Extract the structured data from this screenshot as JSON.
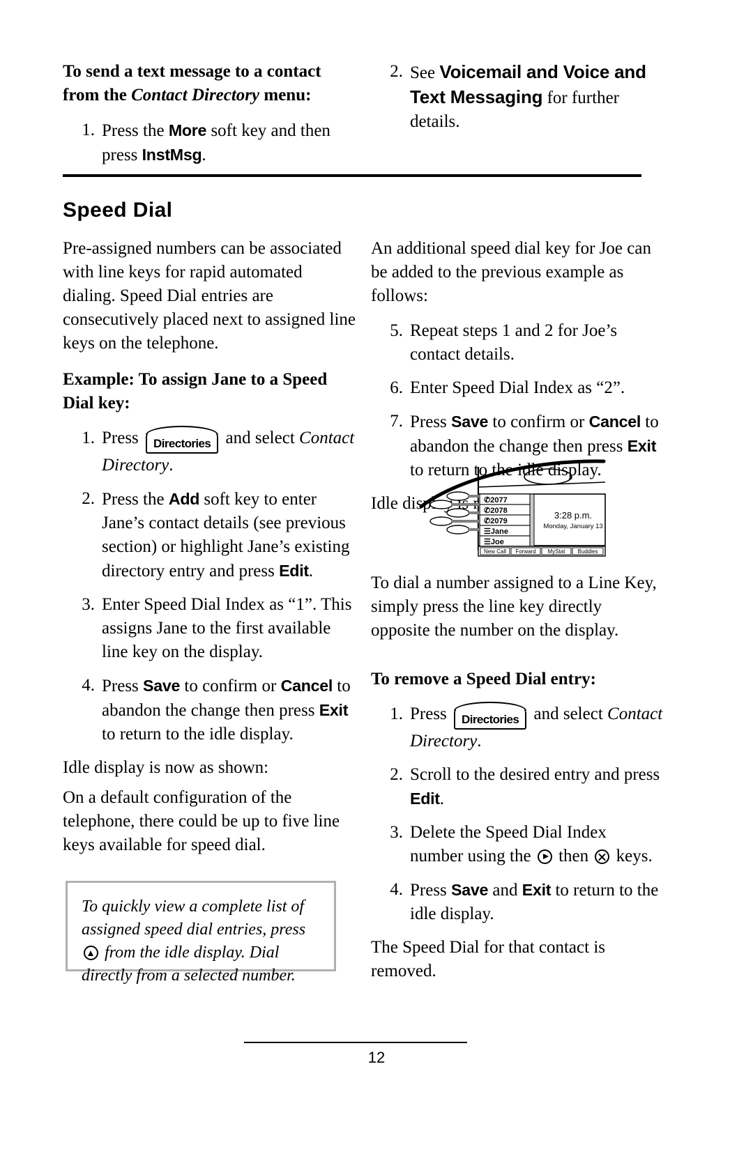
{
  "page": {
    "number": "12"
  },
  "top_left": {
    "heading_part1": "To send a text message to a contact from the ",
    "heading_italic": "Contact Directory",
    "heading_part2": " menu:",
    "steps": [
      {
        "num": "1.",
        "text_a": "Press the ",
        "key_a": "More",
        "text_b": " soft key and then press ",
        "key_b": "InstMsg",
        "text_c": "."
      }
    ]
  },
  "top_right": {
    "steps": [
      {
        "num": "2.",
        "text_a": "See ",
        "bold_a": "Voicemail and Voice and Text Messaging",
        "text_b": " for further details."
      }
    ]
  },
  "section": {
    "title": "Speed Dial"
  },
  "left_column": {
    "intro": "Pre-assigned numbers can be associated with line keys for rapid automated dialing. Speed Dial entries are consecutively placed next to assigned line keys on the telephone.",
    "example_heading": "Example: To assign Jane to a Speed Dial key:",
    "steps": [
      {
        "num": "1.",
        "text_a": "Press ",
        "hardkey": "Directories",
        "text_b": " and select ",
        "italic_b": "Contact Directory",
        "text_c": "."
      },
      {
        "num": "2.",
        "text_a": "Press the ",
        "key_a": "Add",
        "text_b": " soft key to enter Jane’s contact details (see previous section) or highlight Jane’s existing directory entry and press ",
        "key_b": "Edit",
        "text_c": "."
      },
      {
        "num": "3.",
        "text_a": "Enter Speed Dial Index as “1”.  This assigns Jane to the first available line key on the display."
      },
      {
        "num": "4.",
        "text_a": "Press ",
        "key_a": "Save",
        "text_b": " to confirm or ",
        "key_b": "Cancel",
        "text_c": " to abandon the change then press ",
        "key_c": "Exit",
        "text_d": " to return to the idle display."
      }
    ],
    "idle_display_caption": "Idle display is now as shown:",
    "default_config_note": "On a default configuration of the telephone, there could be up to five line keys available for speed dial.",
    "tip_box": {
      "text_a": "To quickly view a complete list of assigned speed dial entries, press ",
      "icon": "nav-up-arrow-key",
      "text_b": " from the idle display.  Dial directly from a selected number."
    }
  },
  "right_column": {
    "additional_intro": "An additional speed dial key for Joe can be added to the previous example as follows:",
    "steps": [
      {
        "num": "5.",
        "text_a": "Repeat steps 1 and 2 for Joe’s contact details."
      },
      {
        "num": "6.",
        "text_a": "Enter Speed Dial Index as “2”."
      },
      {
        "num": "7.",
        "text_a": "Press ",
        "key_a": "Save",
        "text_b": " to confirm or ",
        "key_b": "Cancel",
        "text_c": " to abandon the change then press ",
        "key_c": "Exit",
        "text_d": " to return to the idle display."
      }
    ],
    "idle_display_caption": "Idle display is now as shown:",
    "dial_note": "To dial a number assigned to a Line Key, simply press the line key directly opposite the number on the display.",
    "remove_heading": "To remove a Speed Dial entry:",
    "remove_steps": [
      {
        "num": "1.",
        "text_a": "Press ",
        "hardkey": "Directories",
        "text_b": " and select ",
        "italic_b": "Contact Directory",
        "text_c": "."
      },
      {
        "num": "2.",
        "text_a": "Scroll to the desired entry and press ",
        "key_a": "Edit",
        "text_b": "."
      },
      {
        "num": "3.",
        "text_a": "Delete the Speed Dial Index number using the ",
        "icon_a": "nav-right-arrow-key",
        "text_b": " then ",
        "icon_b": "delete-x-key",
        "text_c": " keys."
      },
      {
        "num": "4.",
        "text_a": "Press ",
        "key_a": "Save",
        "text_b": " and ",
        "key_b": "Exit",
        "text_c": " to return to the idle display."
      }
    ],
    "removed_note": "The Speed Dial for that contact is removed."
  },
  "phone_illustration": {
    "line_keys": [
      "2077",
      "2078",
      "2079",
      "Jane",
      "Joe"
    ],
    "time": "3:28 p.m.",
    "date": "Monday, January 13",
    "soft_keys": [
      "New Call",
      "Forward",
      "MyStat",
      "Buddies"
    ]
  }
}
